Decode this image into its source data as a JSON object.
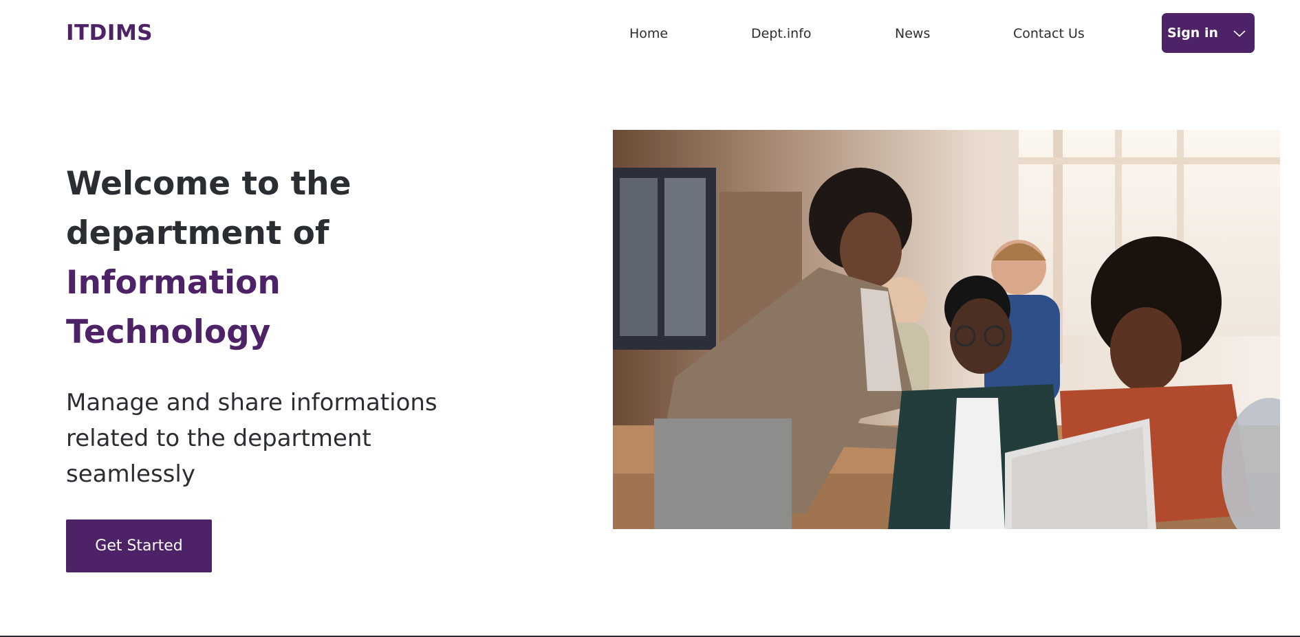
{
  "header": {
    "logo": "ITDIMS",
    "nav": [
      {
        "label": "Home"
      },
      {
        "label": "Dept.info"
      },
      {
        "label": "News"
      },
      {
        "label": "Contact Us"
      }
    ],
    "signin_label": "Sign in",
    "signin_icon": "chevron-down-icon"
  },
  "hero": {
    "title_line1": "Welcome to the",
    "title_line2": "department of",
    "title_accent1": "Information",
    "title_accent2": "Technology",
    "subtitle": "Manage and share informations related to the department seamlessly",
    "cta_label": "Get Started",
    "image_subject": "classroom photo: teacher helping students at a laptop"
  },
  "colors": {
    "brand": "#4e2266",
    "text": "#2a2d32",
    "background": "#ffffff"
  }
}
